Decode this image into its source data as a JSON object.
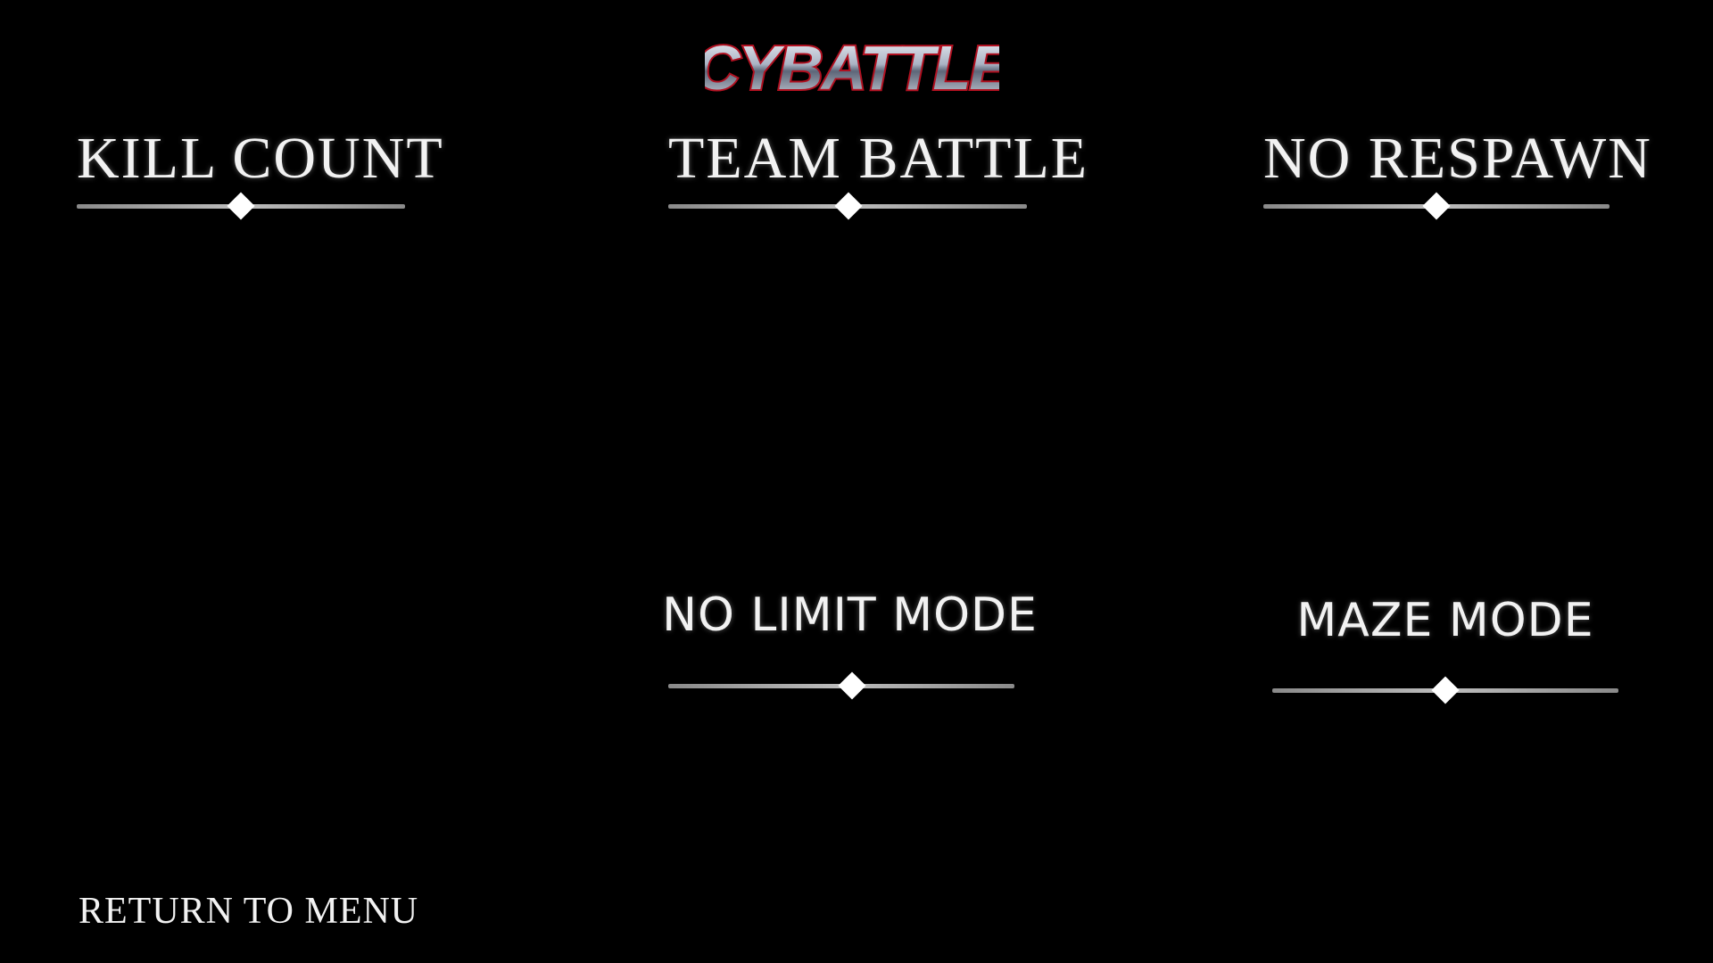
{
  "header": {
    "logo_text": "CYBATTLE"
  },
  "modes": {
    "kill_count": "KILL COUNT",
    "team_battle": "TEAM BATTLE",
    "no_respawn": "NO RESPAWN",
    "no_limit_mode": "NO LIMIT MODE",
    "maze_mode": "MAZE MODE"
  },
  "footer": {
    "return_label": "RETURN TO MENU"
  },
  "colors": {
    "background": "#000000",
    "text": "#f2f2f2",
    "logo_fill": "#c8cfdc",
    "logo_outline": "#b01020"
  }
}
